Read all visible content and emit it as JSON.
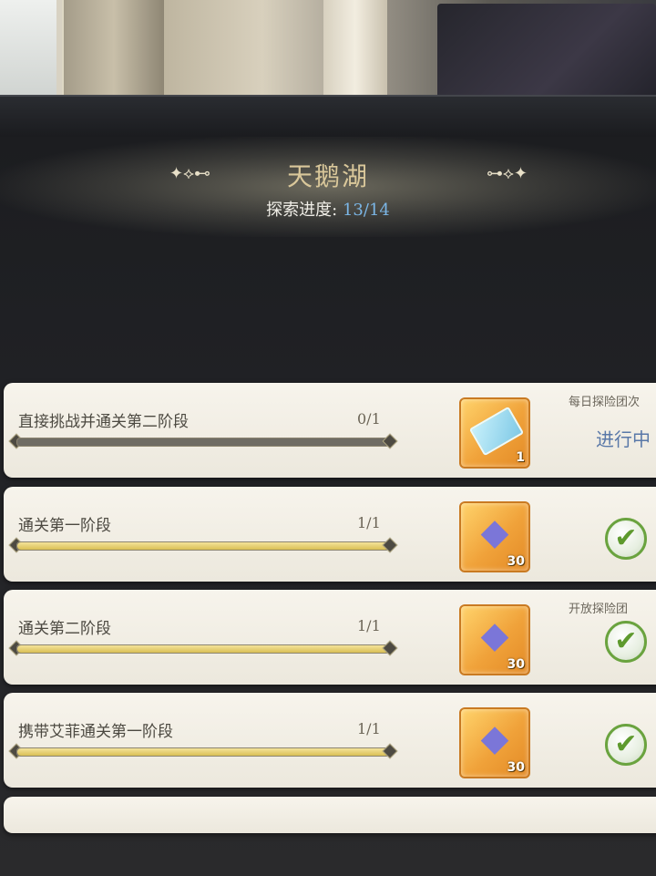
{
  "stage": {
    "title": "天鹅湖",
    "progress_label": "探索进度:",
    "progress_value": "13/14",
    "ornament_left": "✦⟡⊷",
    "ornament_right": "⊶⟡✦"
  },
  "quests": [
    {
      "task": "直接挑战并通关第二阶段",
      "count": "0/1",
      "progress": 0.0,
      "reward_icon": "ticket-icon",
      "reward_qty": "1",
      "note": "每日探险团次",
      "status": "进行中",
      "completed": false
    },
    {
      "task": "通关第一阶段",
      "count": "1/1",
      "progress": 1.0,
      "reward_icon": "crystal-icon",
      "reward_qty": "30",
      "note": "",
      "status": "",
      "completed": true
    },
    {
      "task": "通关第二阶段",
      "count": "1/1",
      "progress": 1.0,
      "reward_icon": "crystal-icon",
      "reward_qty": "30",
      "note": "开放探险团",
      "status": "",
      "completed": true
    },
    {
      "task": "携带艾菲通关第一阶段",
      "count": "1/1",
      "progress": 1.0,
      "reward_icon": "crystal-icon",
      "reward_qty": "30",
      "note": "",
      "status": "",
      "completed": true
    }
  ],
  "colors": {
    "title": "#d9c79a",
    "progress_value": "#7bb6e6",
    "bar_fill": "#d9bf55",
    "check": "#5e9a2e"
  }
}
